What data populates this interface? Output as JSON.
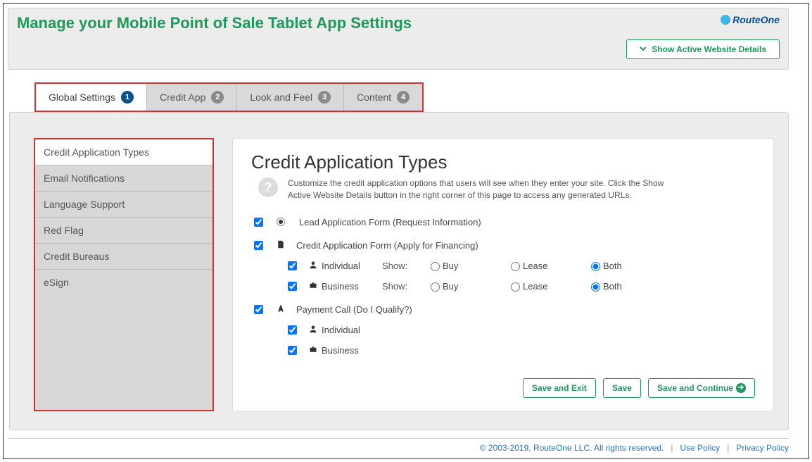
{
  "header": {
    "title": "Manage your Mobile Point of Sale Tablet App Settings",
    "brand": "RouteOne",
    "show_details": "Show Active Website Details"
  },
  "tabs": [
    {
      "label": "Global Settings",
      "num": "1",
      "active": true
    },
    {
      "label": "Credit App",
      "num": "2",
      "active": false
    },
    {
      "label": "Look and Feel",
      "num": "3",
      "active": false
    },
    {
      "label": "Content",
      "num": "4",
      "active": false
    }
  ],
  "sidebar": [
    {
      "label": "Credit Application Types",
      "active": true
    },
    {
      "label": "Email Notifications",
      "active": false
    },
    {
      "label": "Language Support",
      "active": false
    },
    {
      "label": "Red Flag",
      "active": false
    },
    {
      "label": "Credit Bureaus",
      "active": false
    },
    {
      "label": "eSign",
      "active": false
    }
  ],
  "main": {
    "heading": "Credit Application Types",
    "desc": "Customize the credit application options that users will see when they enter your site. Click the Show Active Website Details button in the right corner of this page to access any generated URLs.",
    "lead_form": "Lead Application Form (Request Information)",
    "credit_form": "Credit Application Form (Apply for Financing)",
    "individual": "Individual",
    "business": "Business",
    "show": "Show:",
    "buy": "Buy",
    "lease": "Lease",
    "both": "Both",
    "payment_call": "Payment Call (Do I Qualify?)"
  },
  "buttons": {
    "save_exit": "Save and Exit",
    "save": "Save",
    "save_continue": "Save and Continue"
  },
  "footer": {
    "copy": "© 2003-2019, RouteOne LLC. All rights reserved.",
    "use": "Use Policy",
    "privacy": "Privacy Policy"
  }
}
